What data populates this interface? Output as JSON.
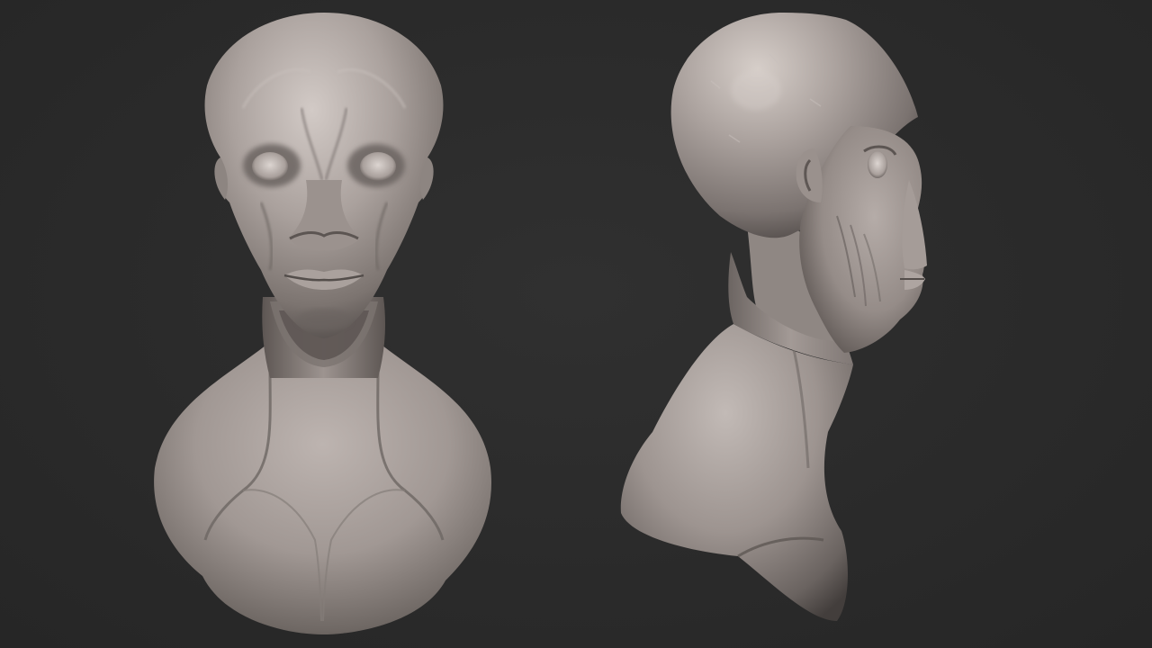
{
  "scene": {
    "background_color": "#2b2b2b",
    "material_color": "#9a918d",
    "material_highlight": "#cfc7c2",
    "material_shadow": "#4a4442",
    "views": [
      {
        "name": "front-view",
        "subject": "alien-bust"
      },
      {
        "name": "side-view",
        "subject": "alien-bust"
      }
    ]
  }
}
